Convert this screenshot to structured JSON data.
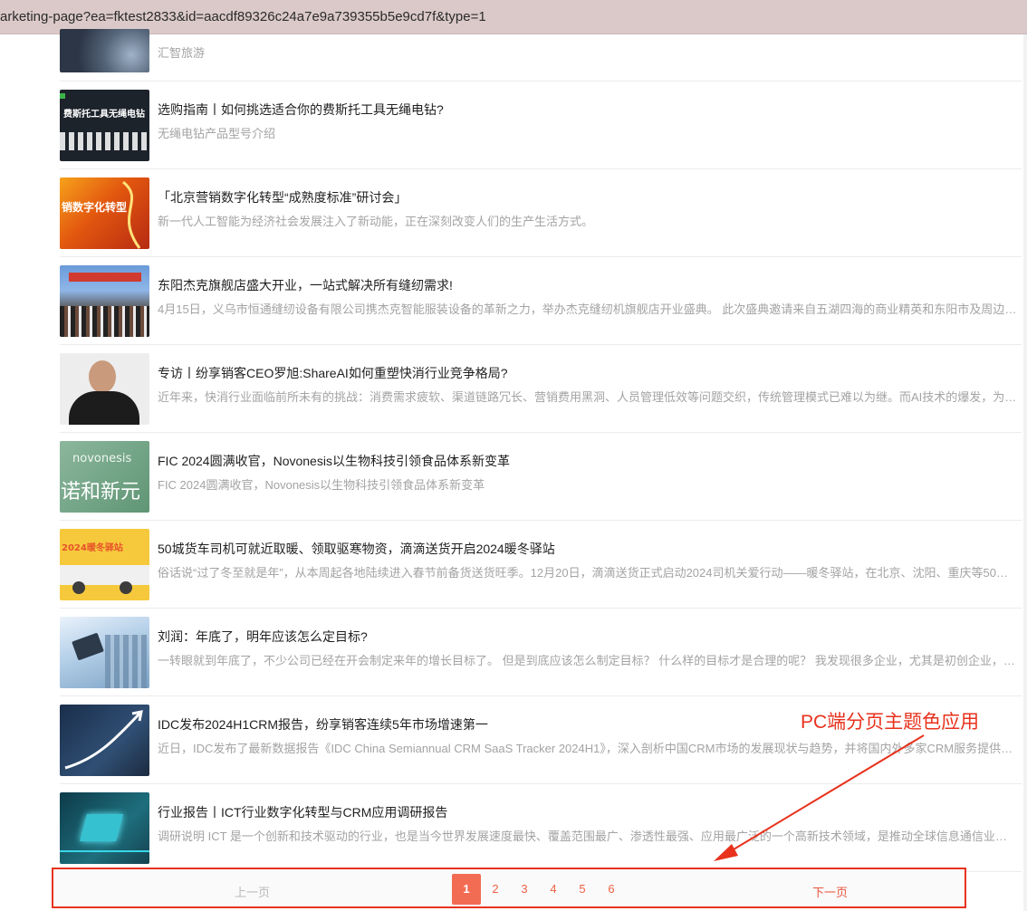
{
  "browser": {
    "url": "arketing-page?ea=fktest2833&id=aacdf89326c24a7e9a739355b5e9cd7f&type=1"
  },
  "articles": [
    {
      "title": "",
      "desc": "汇智旅游",
      "thumb_icon": "storm-satellite-image"
    },
    {
      "title": "选购指南丨如何挑选适合你的费斯托工具无绳电钻?",
      "desc": "无绳电钻产品型号介绍",
      "thumb_icon": "festool-drill-guide-image",
      "thumb_text": "费斯托工具无绳电钻"
    },
    {
      "title": "「北京营销数字化转型“成熟度标准”研讨会」",
      "desc": "新一代人工智能为经济社会发展注入了新动能，正在深刻改变人们的生产生活方式。",
      "thumb_icon": "seminar-poster-image",
      "thumb_text": "销数字化转型"
    },
    {
      "title": "东阳杰克旗舰店盛大开业，一站式解决所有缝纫需求!",
      "desc": "4月15日，义乌市恒通缝纫设备有限公司携杰克智能服装设备的革新之力，举办杰克缝纫机旗舰店开业盛典。 此次盛典邀请来自五湖四海的商业精英和东阳市及周边地区…",
      "thumb_icon": "store-opening-photo"
    },
    {
      "title": "专访丨纷享销客CEO罗旭:ShareAI如何重塑快消行业竞争格局?",
      "desc": "近年来，快消行业面临前所未有的挑战：消费需求疲软、渠道链路冗长、营销费用黑洞、人员管理低效等问题交织，传统管理模式已难以为继。而AI技术的爆发，为这一“…",
      "thumb_icon": "ceo-portrait-photo"
    },
    {
      "title": "FIC 2024圆满收官，Novonesis以生物科技引领食品体系新变革",
      "desc": "FIC 2024圆满收官，Novonesis以生物科技引领食品体系新变革",
      "thumb_icon": "novonesis-logo-image",
      "thumb_text": "novonesis",
      "thumb_text_cn": "诺和新元"
    },
    {
      "title": "50城货车司机可就近取暖、领取驱寒物资，滴滴送货开启2024暖冬驿站",
      "desc": "俗话说“过了冬至就是年”，从本周起各地陆续进入春节前备货送货旺季。12月20日，滴滴送货正式启动2024司机关爱行动——暖冬驿站，在北京、沈阳、重庆等50城170…",
      "thumb_icon": "delivery-truck-illustration",
      "thumb_text": "2024暖冬驿站"
    },
    {
      "title": "刘润：年底了，明年应该怎么定目标?",
      "desc": "一转眼就到年底了，不少公司已经在开会制定来年的增长目标了。 但是到底应该怎么制定目标？ 什么样的目标才是合理的呢？ 我发现很多企业，尤其是初创企业，在设…",
      "thumb_icon": "city-tablet-image"
    },
    {
      "title": "IDC发布2024H1CRM报告，纷享销客连续5年市场增速第一",
      "desc": "近日，IDC发布了最新数据报告《IDC China Semiannual CRM SaaS Tracker 2024H1》，深入剖析中国CRM市场的发展现状与趋势，并将国内外多家CRM服务提供商进…",
      "thumb_icon": "growth-chart-image"
    },
    {
      "title": "行业报告丨ICT行业数字化转型与CRM应用调研报告",
      "desc": "调研说明 ICT 是一个创新和技术驱动的行业，也是当今世界发展速度最快、覆盖范围最广、渗透性最强、应用最广泛的一个高新技术领域，是推动全球信息通信业发展的…",
      "thumb_icon": "chip-circuit-image"
    }
  ],
  "pagination": {
    "prev_label": "上一页",
    "next_label": "下一页",
    "pages": [
      "1",
      "2",
      "3",
      "4",
      "5",
      "6"
    ],
    "current_page": 1,
    "theme_color": "#f26c53"
  },
  "annotation": {
    "label": "PC端分页主题色应用",
    "color": "#e8321d"
  }
}
